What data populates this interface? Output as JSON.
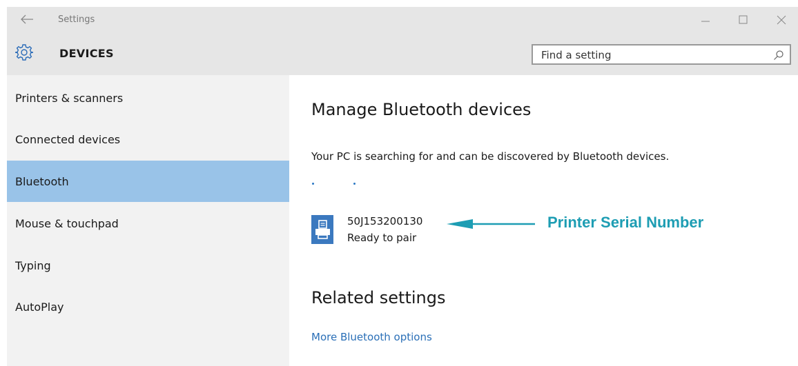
{
  "titlebar": {
    "title": "Settings",
    "back_icon": "back-arrow-icon",
    "controls": [
      "minimize-icon",
      "maximize-icon",
      "close-icon"
    ]
  },
  "header": {
    "icon": "gear-icon",
    "title": "DEVICES",
    "search": {
      "placeholder": "Find a setting",
      "value": ""
    }
  },
  "sidebar": {
    "items": [
      {
        "label": "Printers & scanners",
        "selected": false
      },
      {
        "label": "Connected devices",
        "selected": false
      },
      {
        "label": "Bluetooth",
        "selected": true
      },
      {
        "label": "Mouse & touchpad",
        "selected": false
      },
      {
        "label": "Typing",
        "selected": false
      },
      {
        "label": "AutoPlay",
        "selected": false
      }
    ]
  },
  "main": {
    "manage_title": "Manage Bluetooth devices",
    "description": "Your PC is searching for and can be discovered by Bluetooth devices.",
    "device": {
      "icon": "printer-icon",
      "name": "50J153200130",
      "status": "Ready to pair"
    },
    "callout": {
      "label": "Printer Serial Number"
    },
    "related_title": "Related settings",
    "related_link": "More Bluetooth options"
  },
  "colors": {
    "accent": "#3b79bf",
    "selected_bg": "#99c3e8",
    "callout": "#1d9db3",
    "link": "#2a6fb7",
    "chrome_bg": "#e6e6e6",
    "sidebar_bg": "#f2f2f2"
  }
}
